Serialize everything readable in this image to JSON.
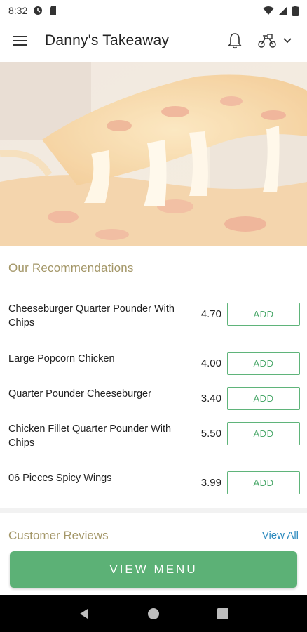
{
  "status_bar": {
    "time": "8:32"
  },
  "app_bar": {
    "title": "Danny's Takeaway"
  },
  "recommendations": {
    "title": "Our Recommendations",
    "items": [
      {
        "name": "Cheeseburger Quarter Pounder With Chips",
        "price": "4.70",
        "button": "ADD"
      },
      {
        "name": "Large Popcorn Chicken",
        "price": "4.00",
        "button": "ADD"
      },
      {
        "name": "Quarter Pounder Cheeseburger",
        "price": "3.40",
        "button": "ADD"
      },
      {
        "name": "Chicken Fillet Quarter Pounder With Chips",
        "price": "5.50",
        "button": "ADD"
      },
      {
        "name": "06 Pieces Spicy Wings",
        "price": "3.99",
        "button": "ADD"
      }
    ]
  },
  "reviews": {
    "title": "Customer Reviews",
    "view_all": "View All"
  },
  "view_menu_label": "VIEW MENU",
  "colors": {
    "accent_green": "#5cb176",
    "section_gold": "#a39667",
    "link_blue": "#2e8bbf"
  },
  "icons": {
    "status": [
      "clock",
      "data-saver-icon",
      "sd-card-icon",
      "wifi-icon",
      "signal-icon",
      "battery-icon"
    ],
    "app_bar": [
      "menu-icon",
      "bell-icon",
      "delivery-scooter-icon",
      "chevron-down-icon"
    ],
    "nav": [
      "back-icon",
      "home-icon",
      "recents-icon"
    ]
  }
}
